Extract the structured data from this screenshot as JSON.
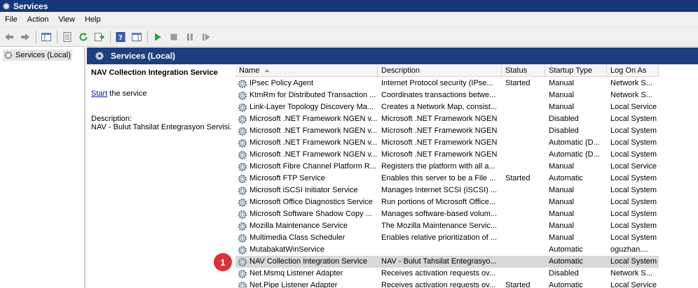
{
  "window": {
    "title": "Services"
  },
  "menu": [
    "File",
    "Action",
    "View",
    "Help"
  ],
  "tree": {
    "selected_item": "Services (Local)"
  },
  "header": {
    "title": "Services (Local)"
  },
  "details": {
    "service_name": "NAV Collection Integration Service",
    "start_link": "Start",
    "start_suffix": " the service",
    "description_label": "Description:",
    "description_text": "NAV - Bulut Tahsilat Entegrasyon Servisi."
  },
  "columns": [
    "Name",
    "Description",
    "Status",
    "Startup Type",
    "Log On As"
  ],
  "sort": {
    "column": "Name",
    "direction": "ascending"
  },
  "rows": [
    {
      "name": "IPsec Policy Agent",
      "description": "Internet Protocol security (IPse...",
      "status": "Started",
      "startup": "Manual",
      "logon": "Network S..."
    },
    {
      "name": "KtmRm for Distributed Transaction ...",
      "description": "Coordinates transactions betwe...",
      "status": "",
      "startup": "Manual",
      "logon": "Network S..."
    },
    {
      "name": "Link-Layer Topology Discovery Ma...",
      "description": "Creates a Network Map, consist...",
      "status": "",
      "startup": "Manual",
      "logon": "Local Service"
    },
    {
      "name": "Microsoft .NET Framework NGEN v...",
      "description": "Microsoft .NET Framework NGEN",
      "status": "",
      "startup": "Disabled",
      "logon": "Local System"
    },
    {
      "name": "Microsoft .NET Framework NGEN v...",
      "description": "Microsoft .NET Framework NGEN",
      "status": "",
      "startup": "Disabled",
      "logon": "Local System"
    },
    {
      "name": "Microsoft .NET Framework NGEN v...",
      "description": "Microsoft .NET Framework NGEN",
      "status": "",
      "startup": "Automatic (D...",
      "logon": "Local System"
    },
    {
      "name": "Microsoft .NET Framework NGEN v...",
      "description": "Microsoft .NET Framework NGEN",
      "status": "",
      "startup": "Automatic (D...",
      "logon": "Local System"
    },
    {
      "name": "Microsoft Fibre Channel Platform R...",
      "description": "Registers the platform with all a...",
      "status": "",
      "startup": "Manual",
      "logon": "Local Service"
    },
    {
      "name": "Microsoft FTP Service",
      "description": "Enables this server to be a File ...",
      "status": "Started",
      "startup": "Automatic",
      "logon": "Local System"
    },
    {
      "name": "Microsoft iSCSI Initiator Service",
      "description": "Manages Internet SCSI (iSCSI) ...",
      "status": "",
      "startup": "Manual",
      "logon": "Local System"
    },
    {
      "name": "Microsoft Office Diagnostics Service",
      "description": "Run portions of Microsoft Office...",
      "status": "",
      "startup": "Manual",
      "logon": "Local System"
    },
    {
      "name": "Microsoft Software Shadow Copy ...",
      "description": "Manages software-based volum...",
      "status": "",
      "startup": "Manual",
      "logon": "Local System"
    },
    {
      "name": "Mozilla Maintenance Service",
      "description": "The Mozilla Maintenance Servic...",
      "status": "",
      "startup": "Manual",
      "logon": "Local System"
    },
    {
      "name": "Multimedia Class Scheduler",
      "description": "Enables relative prioritization of ...",
      "status": "",
      "startup": "Manual",
      "logon": "Local System"
    },
    {
      "name": "MutabakatWinService",
      "description": "",
      "status": "",
      "startup": "Automatic",
      "logon": "oguzhan...."
    },
    {
      "name": "NAV Collection Integration Service",
      "description": "NAV - Bulut Tahsilat Entegrasyo...",
      "status": "",
      "startup": "Automatic",
      "logon": "Local System"
    },
    {
      "name": "Net.Msmq Listener Adapter",
      "description": "Receives activation requests ov...",
      "status": "",
      "startup": "Disabled",
      "logon": "Network S..."
    },
    {
      "name": "Net.Pipe Listener Adapter",
      "description": "Receives activation requests ov...",
      "status": "Started",
      "startup": "Automatic",
      "logon": "Local Service"
    }
  ],
  "selected_row_index": 15,
  "callout": {
    "number": "1"
  },
  "colors": {
    "titlebar": "#15377a",
    "pane_header": "#1d3f7f",
    "selection": "#d9d9d9",
    "callout": "#d9323a",
    "link": "#0a1ea3"
  }
}
